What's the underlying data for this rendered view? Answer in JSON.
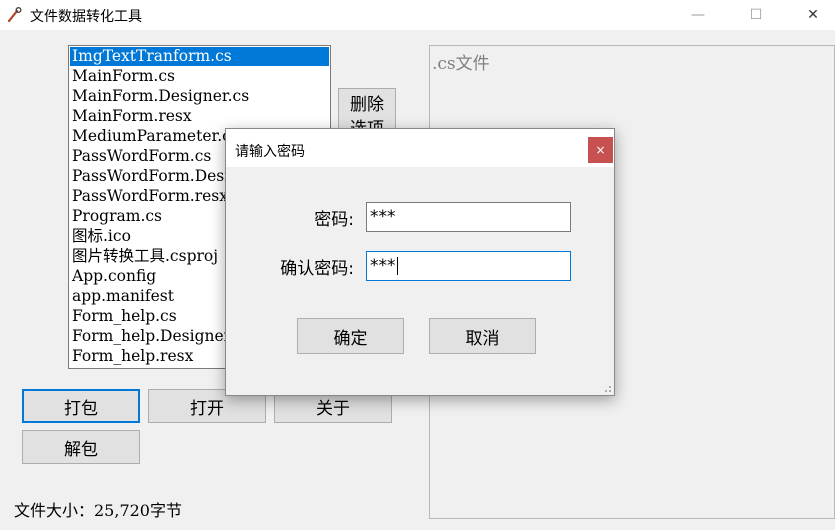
{
  "window": {
    "title": "文件数据转化工具",
    "minimize_symbol": "—",
    "maximize_symbol": "☐",
    "close_symbol": "✕"
  },
  "file_list": {
    "items": [
      "ImgTextTranform.cs",
      "MainForm.cs",
      "MainForm.Designer.cs",
      "MainForm.resx",
      "MediumParameter.cs",
      "PassWordForm.cs",
      "PassWordForm.Designer.cs",
      "PassWordForm.resx",
      "Program.cs",
      "图标.ico",
      "图片转换工具.csproj",
      "App.config",
      "app.manifest",
      "Form_help.cs",
      "Form_help.Designer.cs",
      "Form_help.resx"
    ],
    "selected_index": 0
  },
  "buttons": {
    "delete_line1": "删除",
    "delete_line2": "选项",
    "pack": "打包",
    "open": "打开",
    "about": "关于",
    "unpack": "解包"
  },
  "status": {
    "file_size": "文件大小：25,720字节"
  },
  "preview": {
    "text": ".cs文件"
  },
  "dialog": {
    "title": "请输入密码",
    "close_symbol": "×",
    "password_label": "密码:",
    "password_value": "***",
    "confirm_label": "确认密码:",
    "confirm_value": "***",
    "ok": "确定",
    "cancel": "取消"
  },
  "colors": {
    "selection": "#0078d7",
    "dialog_close": "#c75050",
    "window_bg": "#f0f0f0"
  }
}
